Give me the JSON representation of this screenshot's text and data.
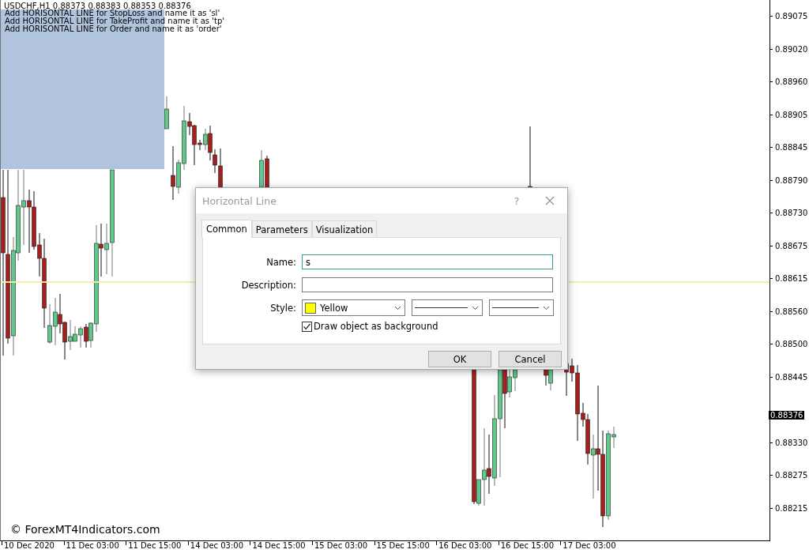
{
  "chart": {
    "header": "USDCHF,H1  0.88373 0.88383 0.88353 0.88376",
    "comment_lines": [
      "Add HORISONTAL LINE for StopLoss and name it as 'sl'",
      "Add HORISONTAL LINE for TakeProfit and name it as 'tp'",
      "Add HORISONTAL LINE for Order and name it as 'order'"
    ],
    "price_ticks": [
      {
        "kind": "tick",
        "label": "0.89075"
      },
      {
        "kind": "tick",
        "label": "0.89020"
      },
      {
        "kind": "tick",
        "label": "0.88960"
      },
      {
        "kind": "tick",
        "label": "0.88905"
      },
      {
        "kind": "tick",
        "label": "0.88845"
      },
      {
        "kind": "tick",
        "label": "0.88790"
      },
      {
        "kind": "tick",
        "label": "0.88730"
      },
      {
        "kind": "tick",
        "label": "0.88675"
      },
      {
        "kind": "tick",
        "label": "0.88615"
      },
      {
        "kind": "tick",
        "label": "0.88560"
      },
      {
        "kind": "tick",
        "label": "0.88500"
      },
      {
        "kind": "tick",
        "label": "0.88445"
      },
      {
        "kind": "current",
        "label": "0.88376"
      },
      {
        "kind": "tick",
        "label": "0.88330"
      },
      {
        "kind": "tick",
        "label": "0.88275"
      },
      {
        "kind": "tick",
        "label": "0.88215"
      }
    ],
    "time_labels": [
      "10 Dec 2020",
      "11 Dec 03:00",
      "11 Dec 15:00",
      "14 Dec 03:00",
      "14 Dec 15:00",
      "15 Dec 03:00",
      "15 Dec 15:00",
      "16 Dec 03:00",
      "16 Dec 15:00",
      "17 Dec 03:00"
    ],
    "copyright": "© ForexMT4Indicators.com"
  },
  "dialog": {
    "title": "Horizontal Line",
    "help": "?",
    "tabs": [
      {
        "label": "Common",
        "selected": true
      },
      {
        "label": "Parameters",
        "selected": false
      },
      {
        "label": "Visualization",
        "selected": false
      }
    ],
    "fields": [
      {
        "kind": "text",
        "label": "Name:",
        "value": "s",
        "focused": true
      },
      {
        "kind": "text",
        "label": "Description:",
        "focused": false
      },
      {
        "kind": "style",
        "label": "Style:",
        "color": "#ffff00",
        "color_name": "Yellow"
      }
    ],
    "checkbox": {
      "label": "Draw object as background",
      "checked": true
    },
    "buttons": [
      "OK",
      "Cancel"
    ]
  }
}
